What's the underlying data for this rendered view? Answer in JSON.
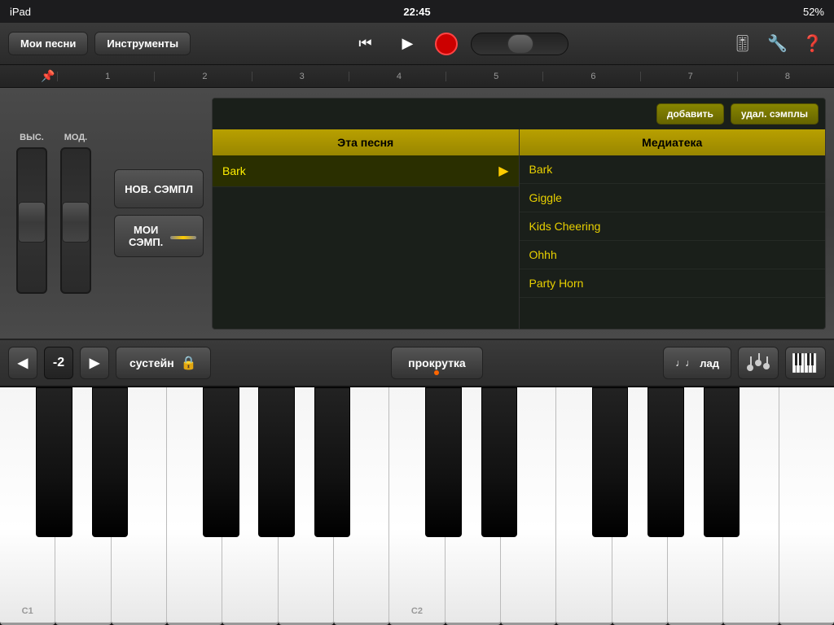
{
  "statusBar": {
    "device": "iPad",
    "time": "22:45",
    "battery": "52%"
  },
  "toolbar": {
    "mySongs": "Мои песни",
    "instruments": "Инструменты"
  },
  "timeline": {
    "marks": [
      "1",
      "2",
      "3",
      "4",
      "5",
      "6",
      "7",
      "8"
    ]
  },
  "pitchMod": {
    "pitchLabel": "ВЫС.",
    "modLabel": "МОД."
  },
  "sampleButtons": {
    "newSample": "НОВ. СЭМПЛ",
    "mySamples": "МОИ СЭМП."
  },
  "sampleToolbar": {
    "addBtn": "добавить",
    "deleteBtn": "удал. сэмплы"
  },
  "columns": {
    "thisSong": "Эта песня",
    "library": "Медиатека"
  },
  "thisSongItems": [
    {
      "name": "Bark",
      "selected": true
    }
  ],
  "libraryItems": [
    {
      "name": "Bark"
    },
    {
      "name": "Giggle"
    },
    {
      "name": "Kids Cheering"
    },
    {
      "name": "Ohhh"
    },
    {
      "name": "Party Horn"
    }
  ],
  "bottomControls": {
    "octaveValue": "-2",
    "sustain": "сустейн",
    "scroll": "прокрутка",
    "scale": "лад",
    "noteIcon": "♩♩"
  },
  "keyLabels": {
    "c1": "C1",
    "c2": "C2"
  }
}
